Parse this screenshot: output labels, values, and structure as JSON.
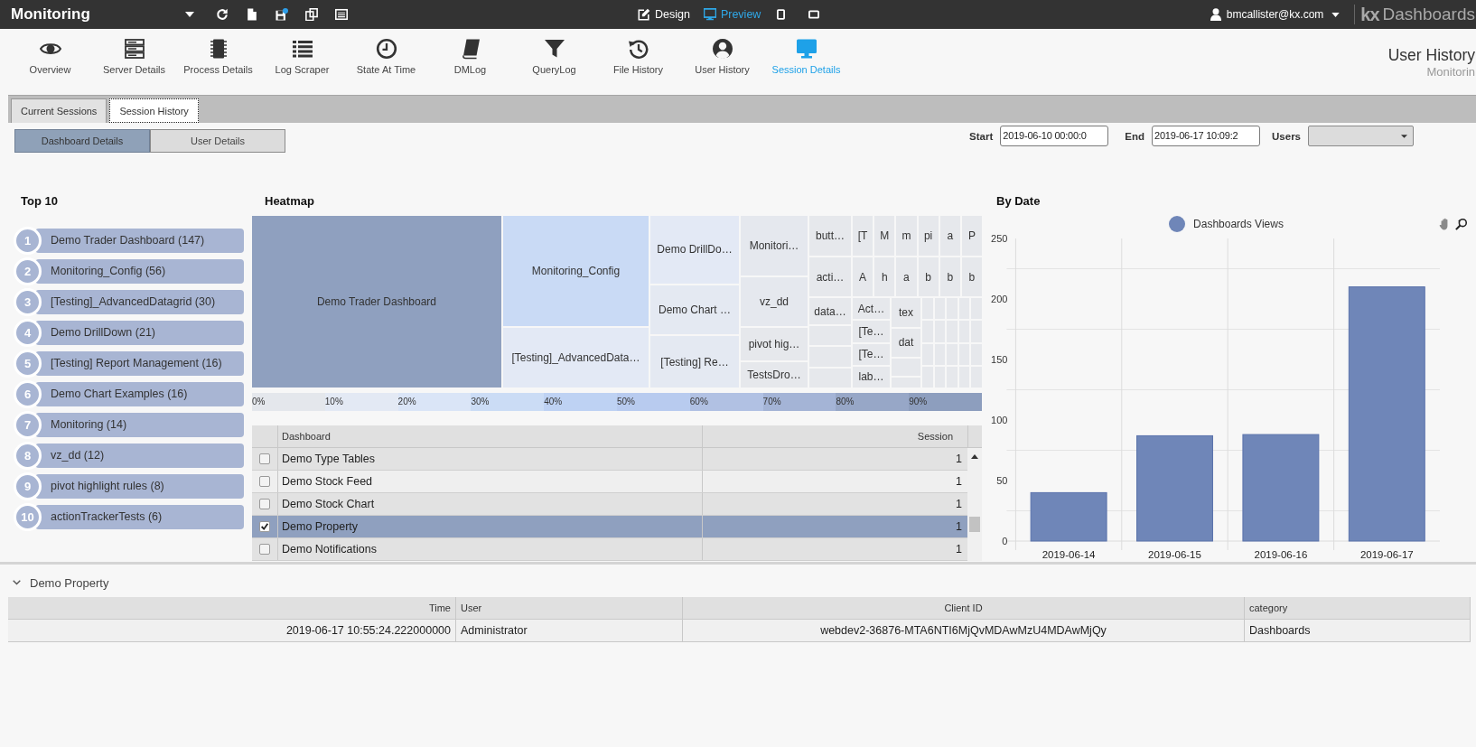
{
  "topbar": {
    "app_title": "Monitoring",
    "modes": [
      {
        "label": "Design",
        "selected": false
      },
      {
        "label": "Preview",
        "selected": true
      }
    ],
    "user": "bmcallister@kx.com",
    "brand_mark": "kx",
    "brand_name": "Dashboards"
  },
  "nav": [
    {
      "label": "Overview",
      "selected": false
    },
    {
      "label": "Server Details",
      "selected": false
    },
    {
      "label": "Process Details",
      "selected": false
    },
    {
      "label": "Log Scraper",
      "selected": false
    },
    {
      "label": "State At Time",
      "selected": false
    },
    {
      "label": "DMLog",
      "selected": false
    },
    {
      "label": "QueryLog",
      "selected": false
    },
    {
      "label": "File History",
      "selected": false
    },
    {
      "label": "User History",
      "selected": false
    },
    {
      "label": "Session Details",
      "selected": true
    }
  ],
  "page_heading": {
    "title": "User History",
    "subtitle": "Monitorin"
  },
  "tabs": [
    {
      "label": "Current Sessions",
      "selected": false
    },
    {
      "label": "Session History",
      "selected": true
    }
  ],
  "view_buttons": [
    {
      "label": "Dashboard Details",
      "selected": true
    },
    {
      "label": "User Details",
      "selected": false
    }
  ],
  "filters": {
    "start": {
      "label": "Start",
      "value": "2019-06-10 00:00:0"
    },
    "end": {
      "label": "End",
      "value": "2019-06-17 10:09:2"
    },
    "users": {
      "label": "Users"
    }
  },
  "top10": {
    "title": "Top 10",
    "items": [
      {
        "rank": "1",
        "label": "Demo Trader Dashboard (147)"
      },
      {
        "rank": "2",
        "label": "Monitoring_Config (56)"
      },
      {
        "rank": "3",
        "label": "[Testing]_AdvancedDatagrid (30)"
      },
      {
        "rank": "4",
        "label": "Demo DrillDown (21)"
      },
      {
        "rank": "5",
        "label": "[Testing] Report Management (16)"
      },
      {
        "rank": "6",
        "label": "Demo Chart Examples (16)"
      },
      {
        "rank": "7",
        "label": "Monitoring (14)"
      },
      {
        "rank": "8",
        "label": "vz_dd (12)"
      },
      {
        "rank": "9",
        "label": "pivot highlight rules (8)"
      },
      {
        "rank": "10",
        "label": "actionTrackerTests (6)"
      }
    ]
  },
  "heatmap": {
    "title": "Heatmap",
    "columns": [
      {
        "cells": [
          {
            "label": "Demo Trader Dashboard",
            "color": "#8fa0bf"
          }
        ]
      },
      {
        "cells": [
          {
            "label": "Monitoring_Config",
            "color": "#c9daf5"
          },
          {
            "label": "[Testing]_AdvancedData…",
            "color": "#e3e9f5"
          }
        ]
      },
      {
        "cells": [
          {
            "label": "Demo DrillDo…",
            "color": "#e3e9f5"
          },
          {
            "label": "Demo Chart …",
            "color": "#e4e9f2"
          },
          {
            "label": "[Testing] Re…",
            "color": "#e4e9f2"
          }
        ]
      },
      {
        "cells": [
          {
            "label": "Monitori…",
            "color": "#e5e8ee"
          },
          {
            "label": "vz_dd",
            "color": "#e5e8ee"
          },
          {
            "label": "pivot hig…",
            "color": "#e6e8ec"
          },
          {
            "label": "TestsDro…",
            "color": "#e6e8ec"
          }
        ]
      }
    ],
    "small_rows": [
      [
        "butt…",
        "[T",
        "M",
        "m",
        "pi",
        "a",
        "P"
      ],
      [
        "acti…",
        "A",
        "h",
        "a",
        "b",
        "b",
        "b"
      ]
    ],
    "small_columns": [
      [
        "data…"
      ],
      [
        "Act…",
        "[Te…",
        "[Te…",
        "lab…"
      ],
      [
        "tex",
        "dat"
      ]
    ],
    "scale": [
      {
        "label": "0%",
        "color": "#e4e7ec"
      },
      {
        "label": "10%",
        "color": "#e3e9f4"
      },
      {
        "label": "20%",
        "color": "#dae5f7"
      },
      {
        "label": "30%",
        "color": "#cbdcf5"
      },
      {
        "label": "40%",
        "color": "#bed2f3"
      },
      {
        "label": "50%",
        "color": "#b8cbef"
      },
      {
        "label": "60%",
        "color": "#b1c1e3"
      },
      {
        "label": "70%",
        "color": "#a4b4d6"
      },
      {
        "label": "80%",
        "color": "#97a7c7"
      },
      {
        "label": "90%",
        "color": "#8d9ebe"
      }
    ]
  },
  "dashboard_table": {
    "columns": [
      "Dashboard",
      "Session"
    ],
    "rows": [
      {
        "cells": [
          "Demo Type Tables",
          "1"
        ],
        "checked": false,
        "selected": false
      },
      {
        "cells": [
          "Demo Stock Feed",
          "1"
        ],
        "checked": false,
        "selected": false
      },
      {
        "cells": [
          "Demo Stock Chart",
          "1"
        ],
        "checked": false,
        "selected": false
      },
      {
        "cells": [
          "Demo Property",
          "1"
        ],
        "checked": true,
        "selected": true
      },
      {
        "cells": [
          "Demo Notifications",
          "1"
        ],
        "checked": false,
        "selected": false
      }
    ]
  },
  "by_date": {
    "chart_data": {
      "type": "bar",
      "title": "By Date",
      "categories": [
        "2019-06-14",
        "2019-06-15",
        "2019-06-16",
        "2019-06-17"
      ],
      "series": [
        {
          "name": "Dashboards Views",
          "color": "#6f86b8",
          "values": [
            40,
            87,
            88,
            210
          ]
        }
      ],
      "ylim": [
        0,
        250
      ],
      "yticks": [
        0,
        50,
        100,
        150,
        200,
        250
      ]
    }
  },
  "detail": {
    "title": "Demo Property",
    "expanded": true,
    "columns": [
      "Time",
      "User",
      "Client ID",
      "category"
    ],
    "rows": [
      [
        "2019-06-17 10:55:24.222000000",
        "Administrator",
        "webdev2-36876-MTA6NTI6MjQvMDAwMzU4MDAwMjQy",
        "Dashboards"
      ]
    ]
  }
}
